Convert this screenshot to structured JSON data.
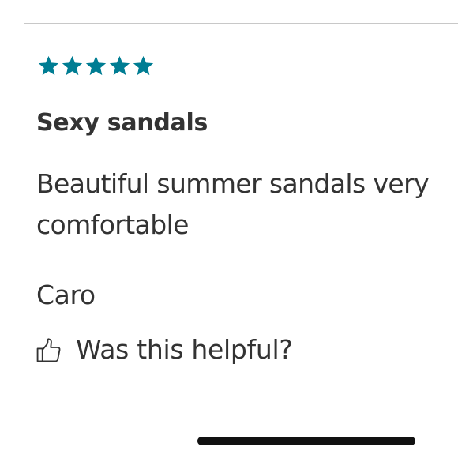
{
  "review": {
    "rating": 5,
    "rating_max": 5,
    "star_color": "#007d93",
    "title": "Sexy sandals",
    "body": "Beautiful summer sandals very comfortable",
    "reviewer": "Caro",
    "helpful": {
      "icon": "thumbs-up-icon",
      "label": "Was this helpful?"
    }
  }
}
